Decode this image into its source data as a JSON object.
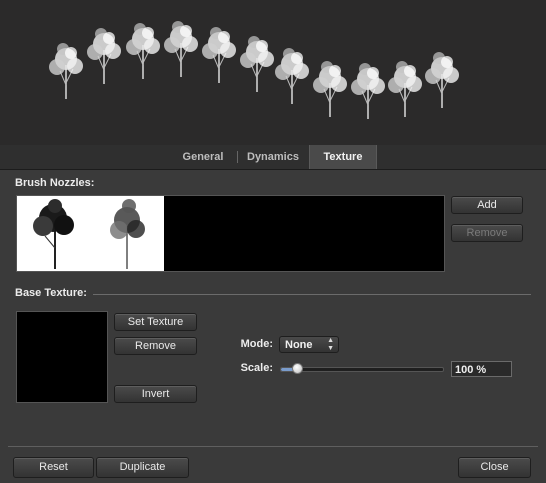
{
  "tabs": [
    {
      "label": "General",
      "active": false
    },
    {
      "label": "Dynamics",
      "active": false
    },
    {
      "label": "Texture",
      "active": true
    }
  ],
  "nozzles": {
    "title": "Brush Nozzles:",
    "add_label": "Add",
    "remove_label": "Remove"
  },
  "texture": {
    "title": "Base Texture:",
    "set_label": "Set Texture",
    "remove_label": "Remove",
    "invert_label": "Invert",
    "mode_label": "Mode:",
    "mode_value": "None",
    "scale_label": "Scale:",
    "scale_value": "100 %",
    "scale_slider_fraction": 0.1
  },
  "footer": {
    "reset_label": "Reset",
    "duplicate_label": "Duplicate",
    "close_label": "Close"
  },
  "colors": {
    "panel_bg": "#3a3a3a",
    "preview_bg": "#2b2a2a",
    "slider_accent": "#7a9ccc"
  }
}
